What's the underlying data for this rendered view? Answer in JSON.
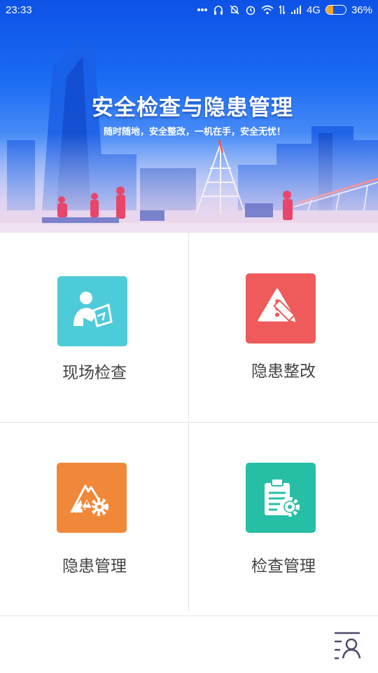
{
  "status_bar": {
    "time": "23:33",
    "network": "4G",
    "battery_percent": "36%",
    "battery_level": 0.36,
    "icons": [
      "more-dots-icon",
      "headset-icon",
      "mute-icon",
      "alarm-icon",
      "wifi-icon",
      "data-transfer-icon",
      "signal-icon",
      "battery-icon"
    ]
  },
  "banner": {
    "title": "安全检查与隐患管理",
    "subtitle": "随时随地，安全整改，一机在手，安全无忧！"
  },
  "menu": {
    "items": [
      {
        "label": "现场检查",
        "icon": "inspector-clipboard-icon",
        "color": "#4ecbd9"
      },
      {
        "label": "隐患整改",
        "icon": "warning-pencil-icon",
        "color": "#ef5a5a"
      },
      {
        "label": "隐患管理",
        "icon": "hazard-gear-icon",
        "color": "#f0883a"
      },
      {
        "label": "检查管理",
        "icon": "document-gear-icon",
        "color": "#26bfa6"
      }
    ]
  },
  "bottom_bar": {
    "icon": "user-list-icon",
    "icon_color": "#4a4a6a"
  }
}
